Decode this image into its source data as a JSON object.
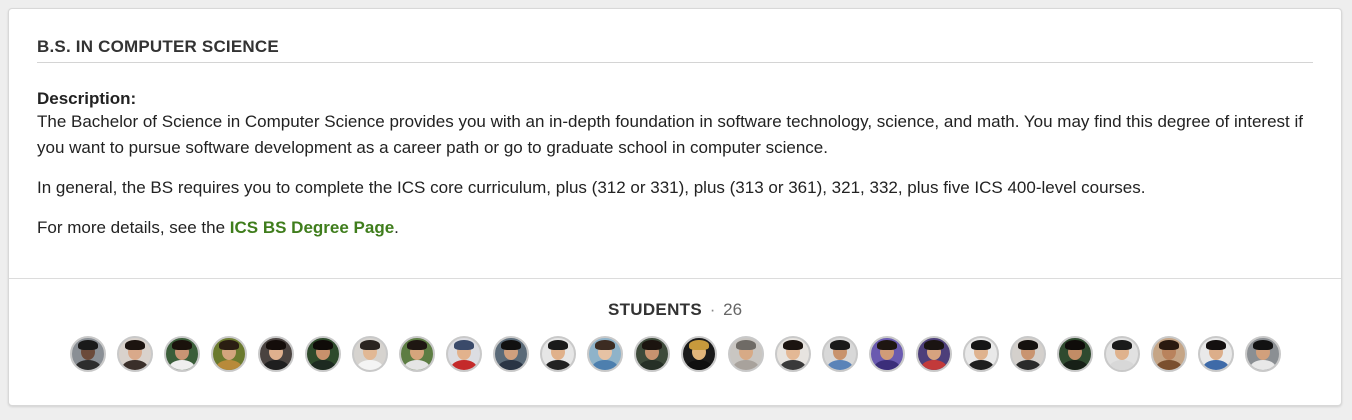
{
  "degree": {
    "title": "B.S. IN COMPUTER SCIENCE",
    "description_label": "Description:",
    "paragraph1": "The Bachelor of Science in Computer Science provides you with an in-depth foundation in software technology, science, and math. You may find this degree of interest if you want to pursue software development as a career path or go to graduate school in computer science.",
    "paragraph2": "In general, the BS requires you to complete the ICS core curriculum, plus (312 or 331), plus (313 or 361), 321, 332, plus five ICS 400-level courses.",
    "details_prefix": "For more details, see the ",
    "details_link": "ICS BS Degree Page",
    "details_suffix": "."
  },
  "students": {
    "label": "STUDENTS",
    "separator": "·",
    "count": "26"
  },
  "avatars": [
    {
      "bg": "#8a8f95",
      "skin": "#6b4a3a",
      "hair": "#1a1a1a",
      "shirt": "#2d2d2d"
    },
    {
      "bg": "#d9d2cc",
      "skin": "#d9a98a",
      "hair": "#1c1410",
      "shirt": "#3a2f2a"
    },
    {
      "bg": "#3b5e3a",
      "skin": "#c99474",
      "hair": "#1a120c",
      "shirt": "#efefef"
    },
    {
      "bg": "#6b7a2e",
      "skin": "#d3a57d",
      "hair": "#2a1e12",
      "shirt": "#b88a3a"
    },
    {
      "bg": "#4a4340",
      "skin": "#dfb08e",
      "hair": "#140d0a",
      "shirt": "#1f1f1f"
    },
    {
      "bg": "#2e4a2b",
      "skin": "#c8916c",
      "hair": "#0f0b08",
      "shirt": "#1d2a20"
    },
    {
      "bg": "#d6d3cf",
      "skin": "#e1b895",
      "hair": "#2a2420",
      "shirt": "#f4f4f4"
    },
    {
      "bg": "#5d7d43",
      "skin": "#d6a57c",
      "hair": "#1e1712",
      "shirt": "#e5e5e5"
    },
    {
      "bg": "#dcdde2",
      "skin": "#e2b28d",
      "hair": "#3a4a6a",
      "shirt": "#c42a2a"
    },
    {
      "bg": "#5a6a78",
      "skin": "#d0a07e",
      "hair": "#111111",
      "shirt": "#2a3545"
    },
    {
      "bg": "#e6e6e6",
      "skin": "#e0b18b",
      "hair": "#1a1a1a",
      "shirt": "#222222"
    },
    {
      "bg": "#8fb3c9",
      "skin": "#e6c2a4",
      "hair": "#3c2c22",
      "shirt": "#4d7fae"
    },
    {
      "bg": "#3d4a3a",
      "skin": "#c8936f",
      "hair": "#1b140f",
      "shirt": "#263026"
    },
    {
      "bg": "#1a1a1a",
      "skin": "#e1b57a",
      "hair": "#c79a3c",
      "shirt": "#0f0f0f"
    },
    {
      "bg": "#c9c6c2",
      "skin": "#d7aa86",
      "hair": "#6f6b66",
      "shirt": "#a8a29c"
    },
    {
      "bg": "#e7e4e0",
      "skin": "#e3b895",
      "hair": "#1b1410",
      "shirt": "#3a3a3a"
    },
    {
      "bg": "#d8d8d8",
      "skin": "#c8936d",
      "hair": "#1a1a1a",
      "shirt": "#5a83b8"
    },
    {
      "bg": "#6a5ab0",
      "skin": "#d19c78",
      "hair": "#1e1612",
      "shirt": "#3b2e7a"
    },
    {
      "bg": "#4d3f7a",
      "skin": "#d6a37f",
      "hair": "#1a1412",
      "shirt": "#c23a3a"
    },
    {
      "bg": "#e9e9e9",
      "skin": "#dfb38f",
      "hair": "#161616",
      "shirt": "#1e1e1e"
    },
    {
      "bg": "#d4d0cc",
      "skin": "#c99470",
      "hair": "#15110e",
      "shirt": "#2a2a2a"
    },
    {
      "bg": "#2f4a2f",
      "skin": "#c18c66",
      "hair": "#0f0c0a",
      "shirt": "#172017"
    },
    {
      "bg": "#e1e1e1",
      "skin": "#dfb28d",
      "hair": "#1a1a1a",
      "shirt": "#d8d8d8"
    },
    {
      "bg": "#c5a586",
      "skin": "#b9835d",
      "hair": "#2a1a10",
      "shirt": "#7a4f2e"
    },
    {
      "bg": "#e9e9e9",
      "skin": "#dcae8a",
      "hair": "#141010",
      "shirt": "#3e6aa8"
    },
    {
      "bg": "#8b8f93",
      "skin": "#d2a07c",
      "hair": "#121212",
      "shirt": "#e8e8e8"
    }
  ]
}
